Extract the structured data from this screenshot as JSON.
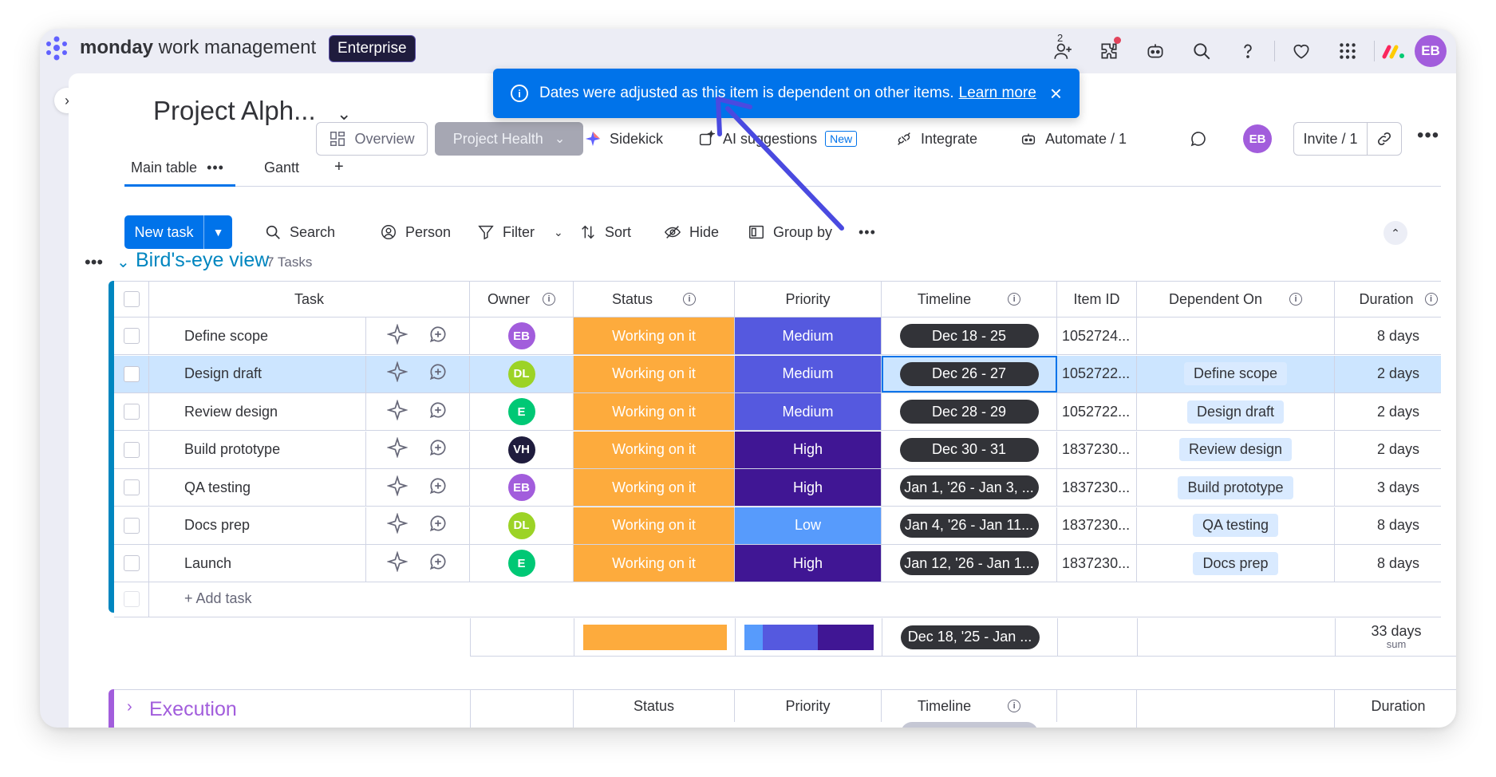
{
  "brand": {
    "name_bold": "monday",
    "name_rest": " work management",
    "plan": "Enterprise"
  },
  "topbar": {
    "notification_count": "2"
  },
  "toast": {
    "message": "Dates were adjusted as this item is dependent on other items.",
    "link": "Learn more",
    "close": "×"
  },
  "header": {
    "project_title": "Project Alph...",
    "overview": "Overview",
    "project_health": "Project Health",
    "sidekick": "Sidekick",
    "ai_suggestions": "AI suggestions",
    "new_badge": "New",
    "integrate": "Integrate",
    "automate": "Automate / 1",
    "avatar": "EB",
    "invite": "Invite / 1"
  },
  "tabs": [
    {
      "label": "Main table"
    },
    {
      "label": "Gantt"
    }
  ],
  "toolbar": {
    "new_task": "New task",
    "search": "Search",
    "person": "Person",
    "filter": "Filter",
    "sort": "Sort",
    "hide": "Hide",
    "group_by": "Group by"
  },
  "group": {
    "title": "Bird's-eye view",
    "count": "7 Tasks"
  },
  "columns": {
    "task": "Task",
    "owner": "Owner",
    "status": "Status",
    "priority": "Priority",
    "timeline": "Timeline",
    "item_id": "Item ID",
    "dependent_on": "Dependent On",
    "duration": "Duration"
  },
  "rows": [
    {
      "task": "Define scope",
      "owner": "EB",
      "owner_color": "#a25ddc",
      "status": "Working on it",
      "priority": "Medium",
      "priority_color": "#5559df",
      "timeline": "Dec 18 - 25",
      "item_id": "1052724...",
      "dependent_on": "",
      "duration": "8 days"
    },
    {
      "task": "Design draft",
      "owner": "DL",
      "owner_color": "#9cd326",
      "status": "Working on it",
      "priority": "Medium",
      "priority_color": "#5559df",
      "timeline": "Dec 26 - 27",
      "item_id": "1052722...",
      "dependent_on": "Define scope",
      "duration": "2 days"
    },
    {
      "task": "Review design",
      "owner": "E",
      "owner_color": "#00c875",
      "status": "Working on it",
      "priority": "Medium",
      "priority_color": "#5559df",
      "timeline": "Dec 28 - 29",
      "item_id": "1052722...",
      "dependent_on": "Design draft",
      "duration": "2 days"
    },
    {
      "task": "Build prototype",
      "owner": "VH",
      "owner_color": "#1f1c3d",
      "status": "Working on it",
      "priority": "High",
      "priority_color": "#401694",
      "timeline": "Dec 30 - 31",
      "item_id": "1837230...",
      "dependent_on": "Review design",
      "duration": "2 days"
    },
    {
      "task": "QA testing",
      "owner": "EB",
      "owner_color": "#a25ddc",
      "status": "Working on it",
      "priority": "High",
      "priority_color": "#401694",
      "timeline": "Jan 1, '26 - Jan 3, ...",
      "item_id": "1837230...",
      "dependent_on": "Build prototype",
      "duration": "3 days"
    },
    {
      "task": "Docs prep",
      "owner": "DL",
      "owner_color": "#9cd326",
      "status": "Working on it",
      "priority": "Low",
      "priority_color": "#579bfc",
      "timeline": "Jan 4, '26 - Jan 11...",
      "item_id": "1837230...",
      "dependent_on": "QA testing",
      "duration": "8 days"
    },
    {
      "task": "Launch",
      "owner": "E",
      "owner_color": "#00c875",
      "status": "Working on it",
      "priority": "High",
      "priority_color": "#401694",
      "timeline": "Jan 12, '26 - Jan 1...",
      "item_id": "1837230...",
      "dependent_on": "Docs prep",
      "duration": "8 days"
    }
  ],
  "add_task": "+ Add task",
  "summary": {
    "timeline": "Dec 18, '25 - Jan ...",
    "duration": "33 days",
    "duration_label": "sum"
  },
  "execution": {
    "title": "Execution",
    "status": "Status",
    "priority": "Priority",
    "timeline": "Timeline",
    "duration": "Duration"
  },
  "colors": {
    "status_orange": "#fdab3d",
    "accent_blue": "#0073ea",
    "group_blue": "#0086c0",
    "group_purple": "#a25ddc"
  }
}
